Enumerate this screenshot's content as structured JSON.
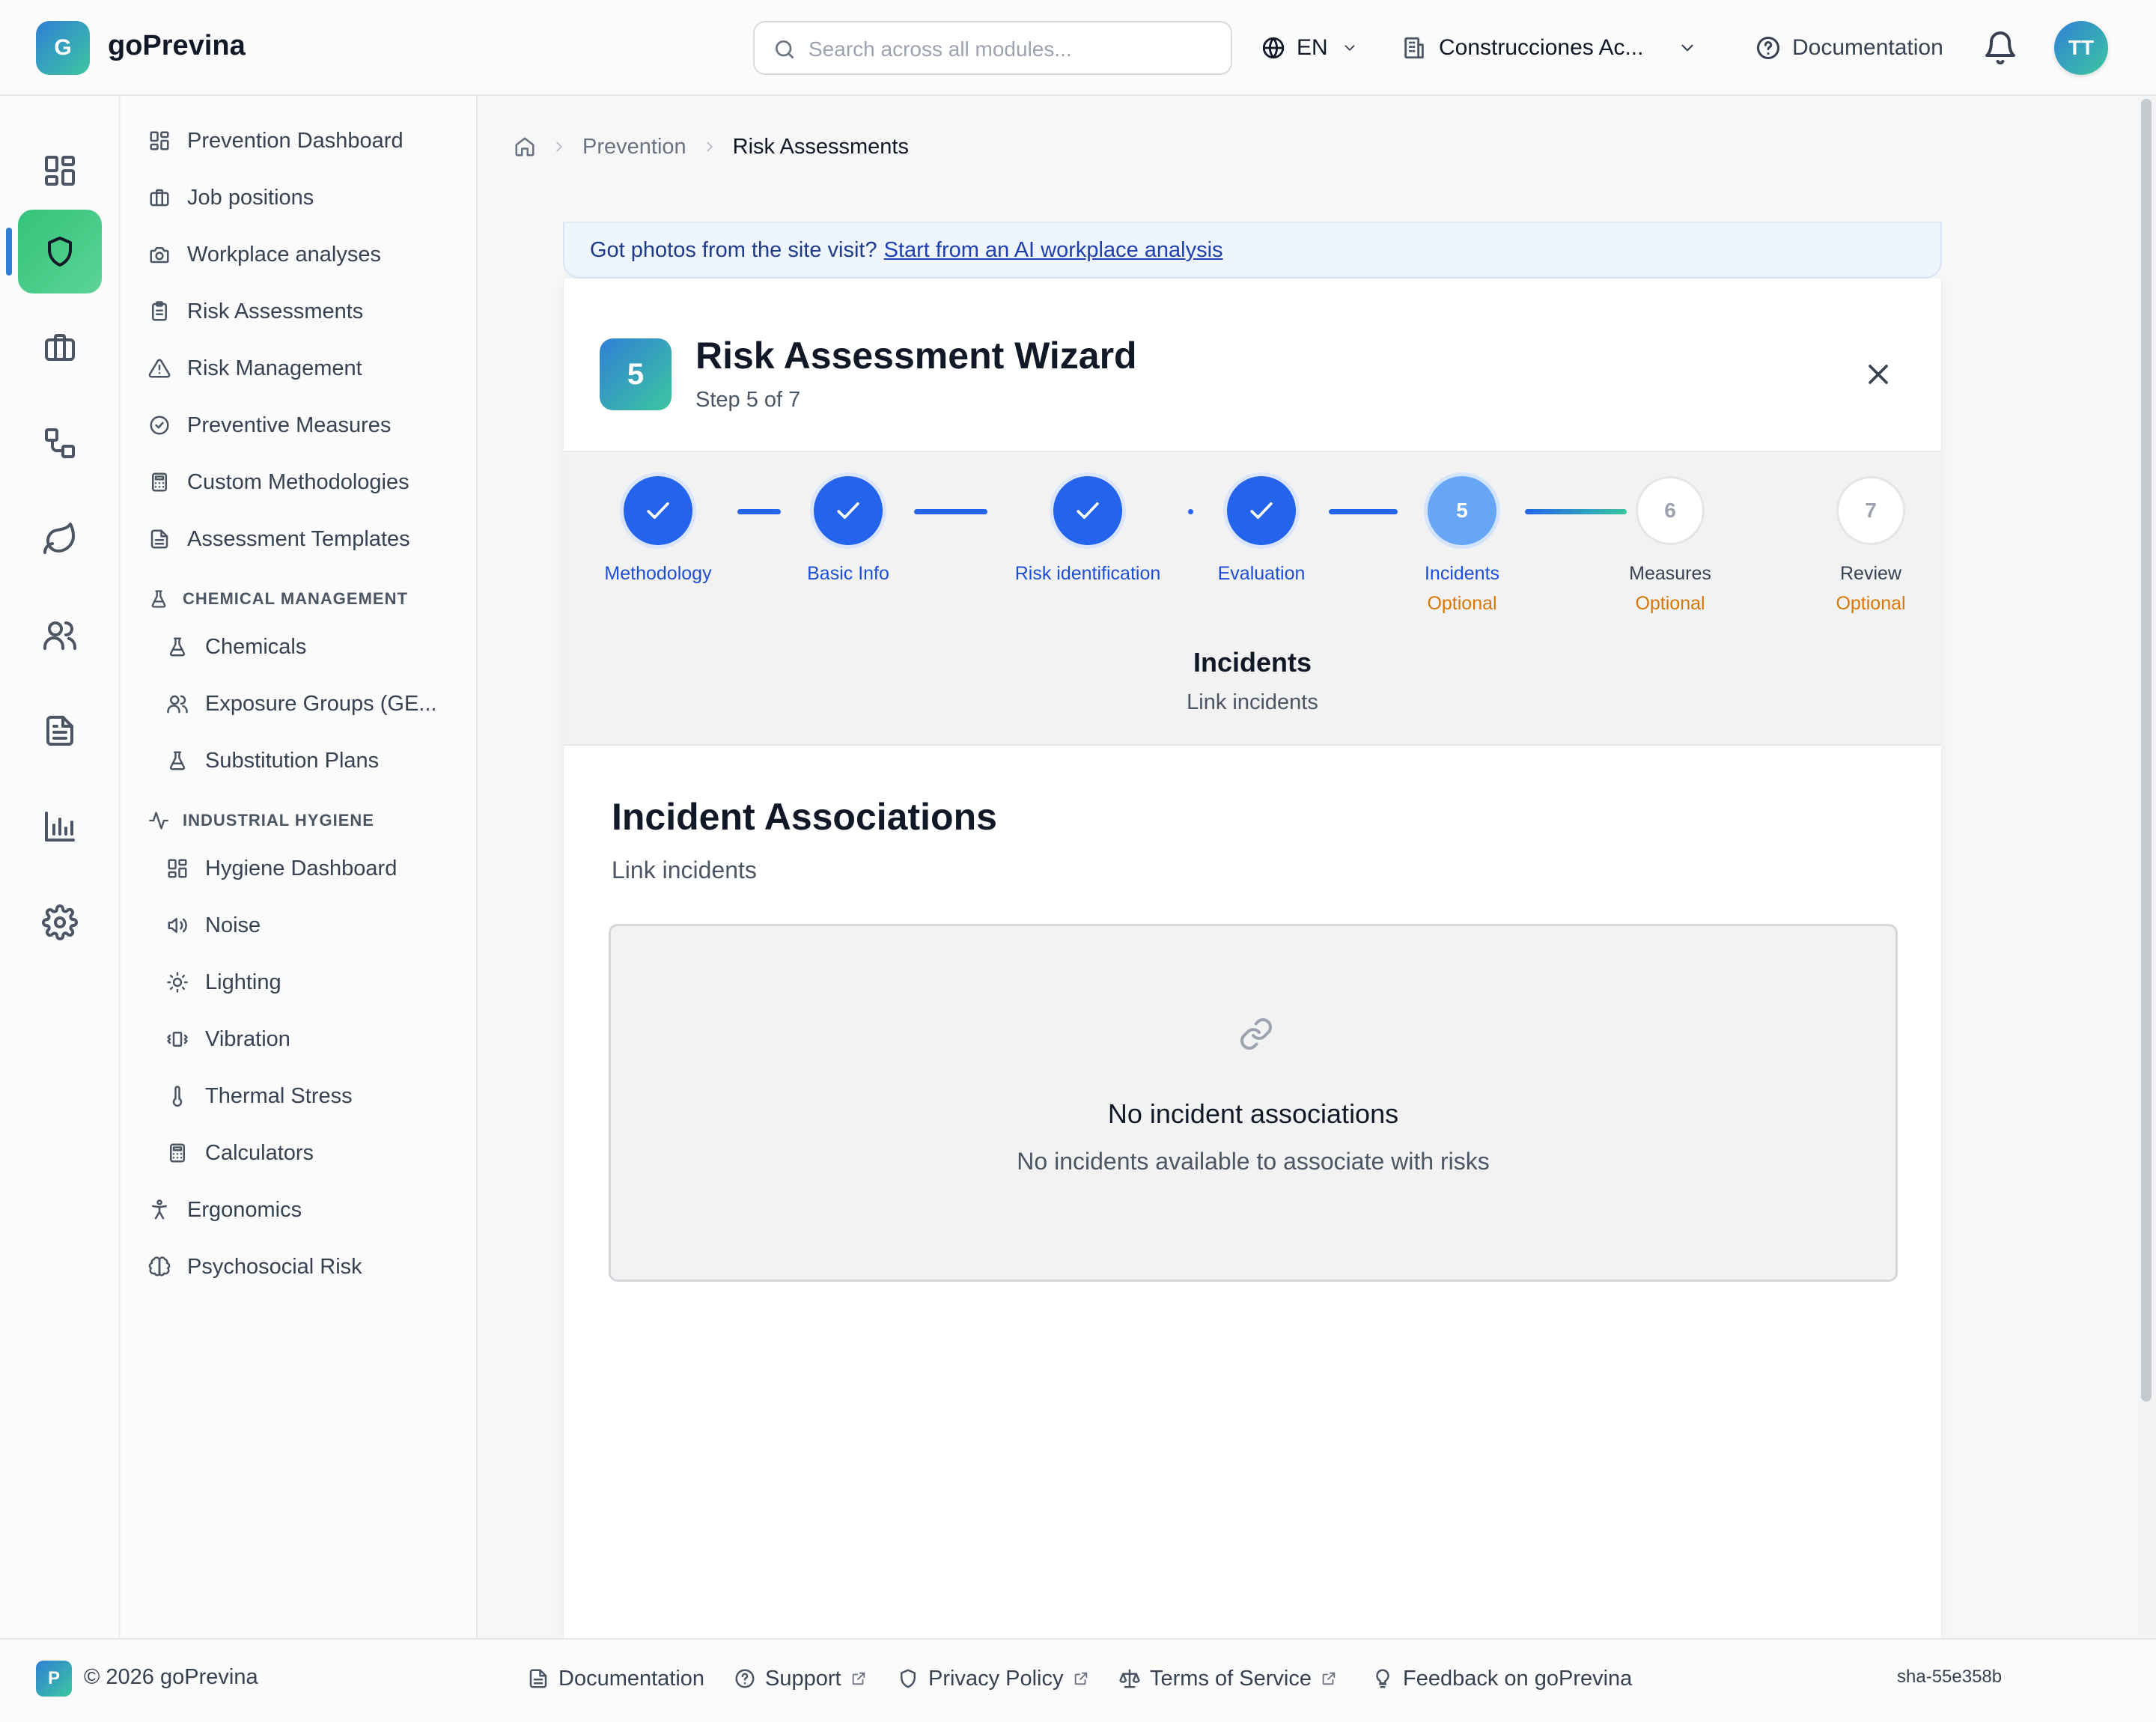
{
  "header": {
    "brand_initial": "G",
    "brand_name": "goPrevina",
    "search_placeholder": "Search across all modules...",
    "language": "EN",
    "company": "Construcciones Ac...",
    "documentation": "Documentation",
    "avatar_initials": "TT"
  },
  "sidebar": {
    "items_top": [
      {
        "label": "Prevention Dashboard",
        "icon": "dashboard-icon"
      },
      {
        "label": "Job positions",
        "icon": "briefcase-icon"
      },
      {
        "label": "Workplace analyses",
        "icon": "camera-icon"
      },
      {
        "label": "Risk Assessments",
        "icon": "clipboard-icon"
      },
      {
        "label": "Risk Management",
        "icon": "warning-icon"
      },
      {
        "label": "Preventive Measures",
        "icon": "check-circle-icon"
      },
      {
        "label": "Custom Methodologies",
        "icon": "calculator-icon"
      },
      {
        "label": "Assessment Templates",
        "icon": "file-text-icon"
      }
    ],
    "chemical_section": "CHEMICAL MANAGEMENT",
    "chemical_items": [
      {
        "label": "Chemicals",
        "icon": "flask-icon"
      },
      {
        "label": "Exposure Groups (GE...",
        "icon": "users-icon"
      },
      {
        "label": "Substitution Plans",
        "icon": "flask-icon"
      }
    ],
    "hygiene_section": "INDUSTRIAL HYGIENE",
    "hygiene_items": [
      {
        "label": "Hygiene Dashboard",
        "icon": "dashboard-icon"
      },
      {
        "label": "Noise",
        "icon": "speaker-icon"
      },
      {
        "label": "Lighting",
        "icon": "sun-icon"
      },
      {
        "label": "Vibration",
        "icon": "vibrate-icon"
      },
      {
        "label": "Thermal Stress",
        "icon": "thermometer-icon"
      },
      {
        "label": "Calculators",
        "icon": "calculator-icon"
      }
    ],
    "items_bottom": [
      {
        "label": "Ergonomics",
        "icon": "person-icon"
      },
      {
        "label": "Psychosocial Risk",
        "icon": "brain-icon"
      }
    ]
  },
  "breadcrumb": {
    "parent": "Prevention",
    "current": "Risk Assessments"
  },
  "banner": {
    "text": "Got photos from the site visit?",
    "link": "Start from an AI workplace analysis"
  },
  "wizard": {
    "badge": "5",
    "title": "Risk Assessment Wizard",
    "step_text": "Step 5 of 7",
    "steps": [
      {
        "label": "Methodology",
        "state": "done",
        "optional": ""
      },
      {
        "label": "Basic Info",
        "state": "done",
        "optional": ""
      },
      {
        "label": "Risk identification",
        "state": "done",
        "optional": ""
      },
      {
        "label": "Evaluation",
        "state": "done",
        "optional": ""
      },
      {
        "label": "Incidents",
        "state": "current",
        "number": "5",
        "optional": "Optional"
      },
      {
        "label": "Measures",
        "state": "pending",
        "number": "6",
        "optional": "Optional"
      },
      {
        "label": "Review",
        "state": "pending",
        "number": "7",
        "optional": "Optional"
      }
    ],
    "current_heading": "Incidents",
    "current_sub": "Link incidents"
  },
  "content": {
    "title": "Incident Associations",
    "subtitle": "Link incidents",
    "empty_title": "No incident associations",
    "empty_sub": "No incidents available to associate with risks"
  },
  "footer": {
    "logo_initial": "P",
    "copyright": "© 2026 goPrevina",
    "links": [
      "Documentation",
      "Support",
      "Privacy Policy",
      "Terms of Service",
      "Feedback on goPrevina"
    ],
    "sha": "sha-55e358b"
  },
  "colors": {
    "accent_blue": "#2463eb",
    "accent_green": "#34c37a",
    "optional_orange": "#d97706"
  }
}
